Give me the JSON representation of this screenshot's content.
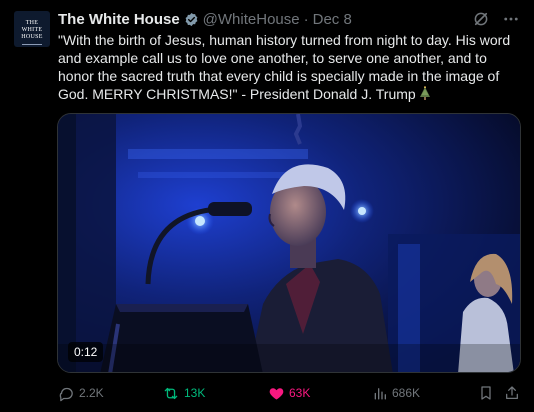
{
  "post": {
    "avatar": {
      "line1": "THE",
      "line2": "WHITE",
      "line3": "HOUSE"
    },
    "author_name": "The White House",
    "verified_badge": "verified-badge-icon",
    "handle": "@WhiteHouse",
    "separator": "·",
    "date": "Dec 8",
    "text": "\"With the birth of Jesus, human history turned from night to day. His word and example call us to love one another, to serve one another, and to honor the sacred truth that every child is specially made in the image of God. MERRY CHRISTMAS!\" - President Donald J. Trump",
    "text_emoji": "christmas-tree-emoji",
    "video": {
      "timestamp": "0:12"
    },
    "actions": {
      "replies": "2.2K",
      "reposts": "13K",
      "likes": "63K",
      "views": "686K"
    }
  },
  "colors": {
    "background": "#000000",
    "text": "#e7e9ea",
    "muted": "#71767b",
    "verified_blue": "#1d9bf0",
    "repost_green": "#00ba7c",
    "like_pink": "#f91880"
  }
}
